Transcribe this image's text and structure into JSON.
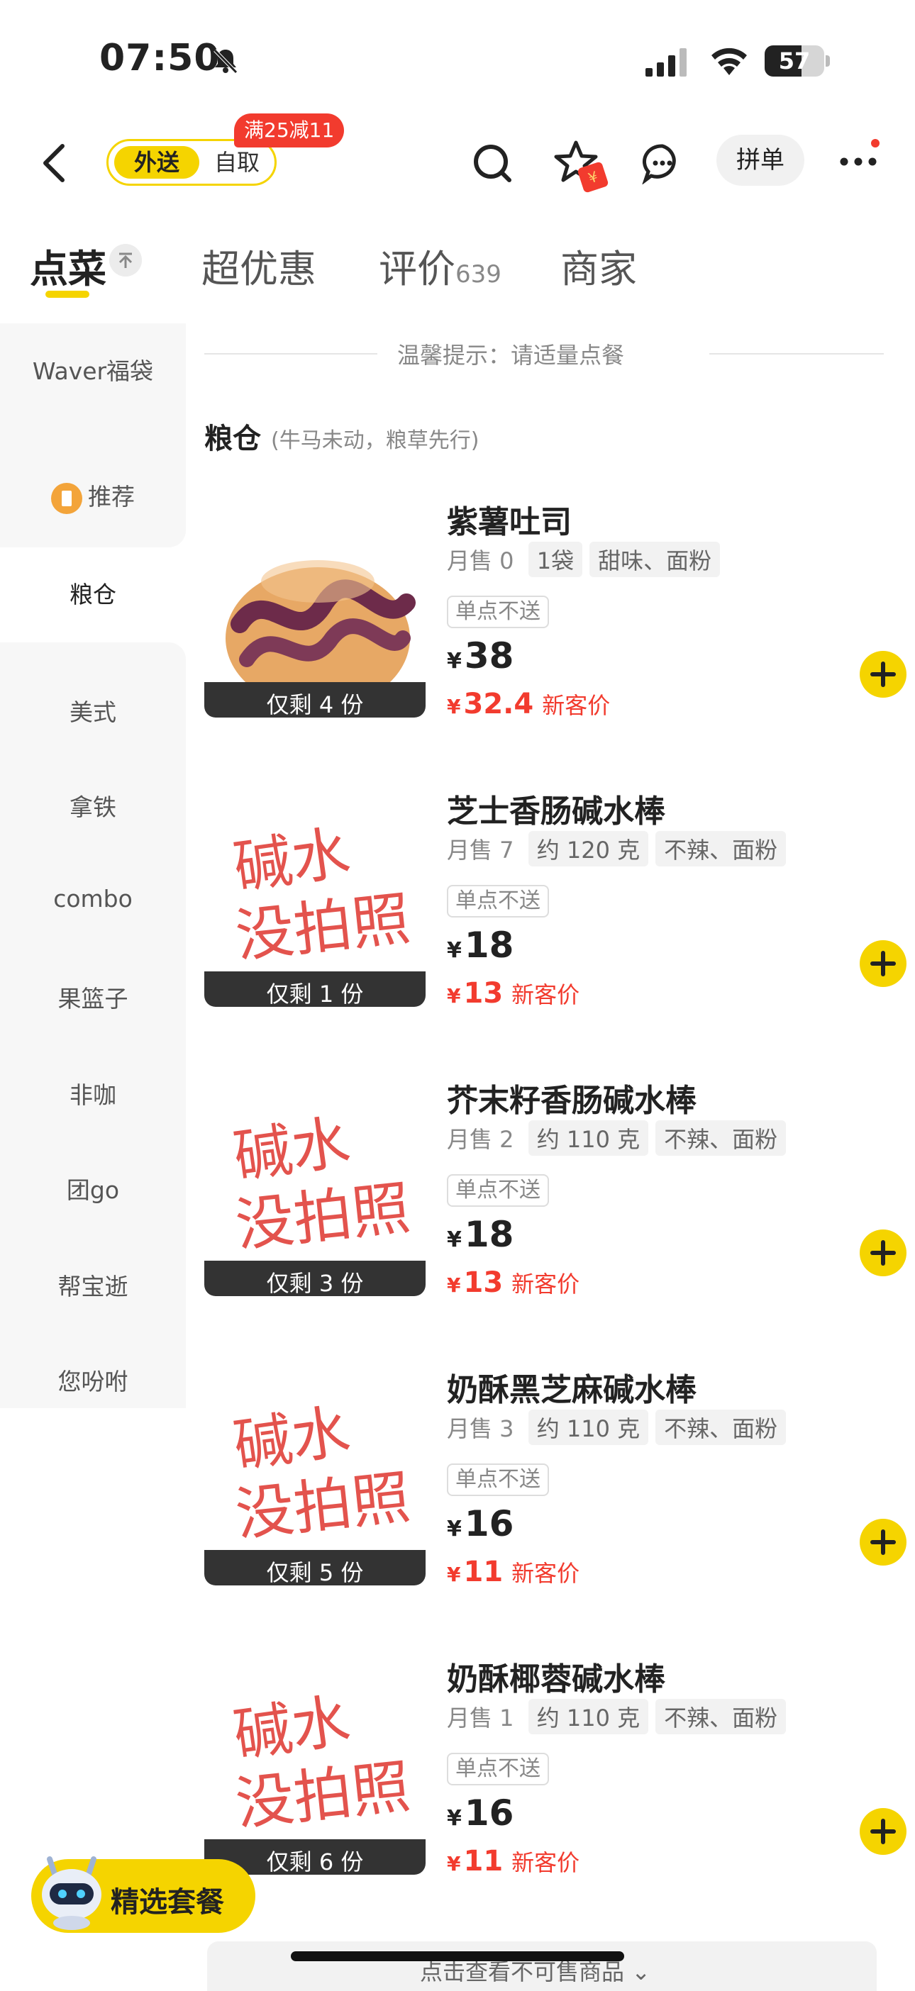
{
  "status": {
    "time": "07:50",
    "battery": "57"
  },
  "header": {
    "mode_active": "外送",
    "mode_inactive": "自取",
    "promo": "满25减11",
    "group_order": "拼单",
    "coupon_symbol": "¥"
  },
  "tabs": [
    {
      "label": "点菜",
      "count": ""
    },
    {
      "label": "超优惠",
      "count": ""
    },
    {
      "label": "评价",
      "count": "639"
    },
    {
      "label": "商家",
      "count": ""
    }
  ],
  "sidebar": {
    "items": [
      "Waver福袋",
      "推荐",
      "粮仓",
      "美式",
      "拿铁",
      "combo",
      "果篮子",
      "非咖",
      "团go",
      "帮宝逝",
      "您吩咐"
    ],
    "active_index": 2
  },
  "content": {
    "hint": "温馨提示：请适量点餐",
    "section_title": "粮仓",
    "section_sub": "(牛马未动，粮草先行)",
    "products": [
      {
        "name": "紫薯吐司",
        "sales": "月售 0",
        "tags": [
          "1袋",
          "甜味、面粉"
        ],
        "no_single": "单点不送",
        "price": "38",
        "new_price": "32.4",
        "new_label": "新客价",
        "stock": "仅剩 4 份"
      },
      {
        "name": "芝士香肠碱水棒",
        "sales": "月售 7",
        "tags": [
          "约 120 克",
          "不辣、面粉"
        ],
        "no_single": "单点不送",
        "price": "18",
        "new_price": "13",
        "new_label": "新客价",
        "stock": "仅剩 1 份"
      },
      {
        "name": "芥末籽香肠碱水棒",
        "sales": "月售 2",
        "tags": [
          "约 110 克",
          "不辣、面粉"
        ],
        "no_single": "单点不送",
        "price": "18",
        "new_price": "13",
        "new_label": "新客价",
        "stock": "仅剩 3 份"
      },
      {
        "name": "奶酥黑芝麻碱水棒",
        "sales": "月售 3",
        "tags": [
          "约 110 克",
          "不辣、面粉"
        ],
        "no_single": "单点不送",
        "price": "16",
        "new_price": "11",
        "new_label": "新客价",
        "stock": "仅剩 5 份"
      },
      {
        "name": "奶酥椰蓉碱水棒",
        "sales": "月售 1",
        "tags": [
          "约 110 克",
          "不辣、面粉"
        ],
        "no_single": "单点不送",
        "price": "16",
        "new_price": "11",
        "new_label": "新客价",
        "stock": "仅剩 6 份"
      }
    ],
    "placeholder_scrawl": "碱水 没拍照"
  },
  "bottom": {
    "combo_label": "精选套餐",
    "unavailable": "点击查看不可售商品"
  },
  "colors": {
    "accent": "#f5d400",
    "price_red": "#f23b2e"
  },
  "icons": [
    "back-icon",
    "search-icon",
    "star-icon",
    "chat-icon",
    "more-icon",
    "add-icon",
    "robot-icon",
    "bell-mute-icon"
  ]
}
